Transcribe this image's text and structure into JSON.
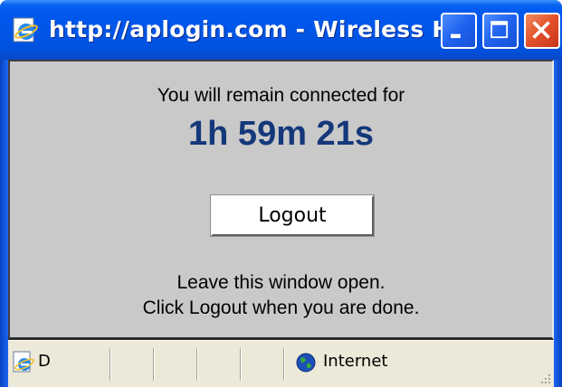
{
  "window": {
    "title": "http://aplogin.com - Wireless H..."
  },
  "titlebar_buttons": {
    "minimize_icon": "minimize-icon",
    "maximize_icon": "maximize-icon",
    "close_icon": "close-icon"
  },
  "content": {
    "message_top": "You will remain connected for",
    "countdown": "1h 59m 21s",
    "logout_label": "Logout",
    "message_bottom_line1": "Leave this window open.",
    "message_bottom_line2": "Click Logout when you are done."
  },
  "statusbar": {
    "status_text": "D",
    "zone_label": "Internet",
    "page_icon": "ie-page-icon",
    "zone_icon": "globe-icon"
  },
  "colors": {
    "titlebar": "#0055e5",
    "client_background": "#c9c9c9",
    "countdown_color": "#14387a",
    "close_button": "#e2502a",
    "statusbar": "#ece9d8"
  }
}
